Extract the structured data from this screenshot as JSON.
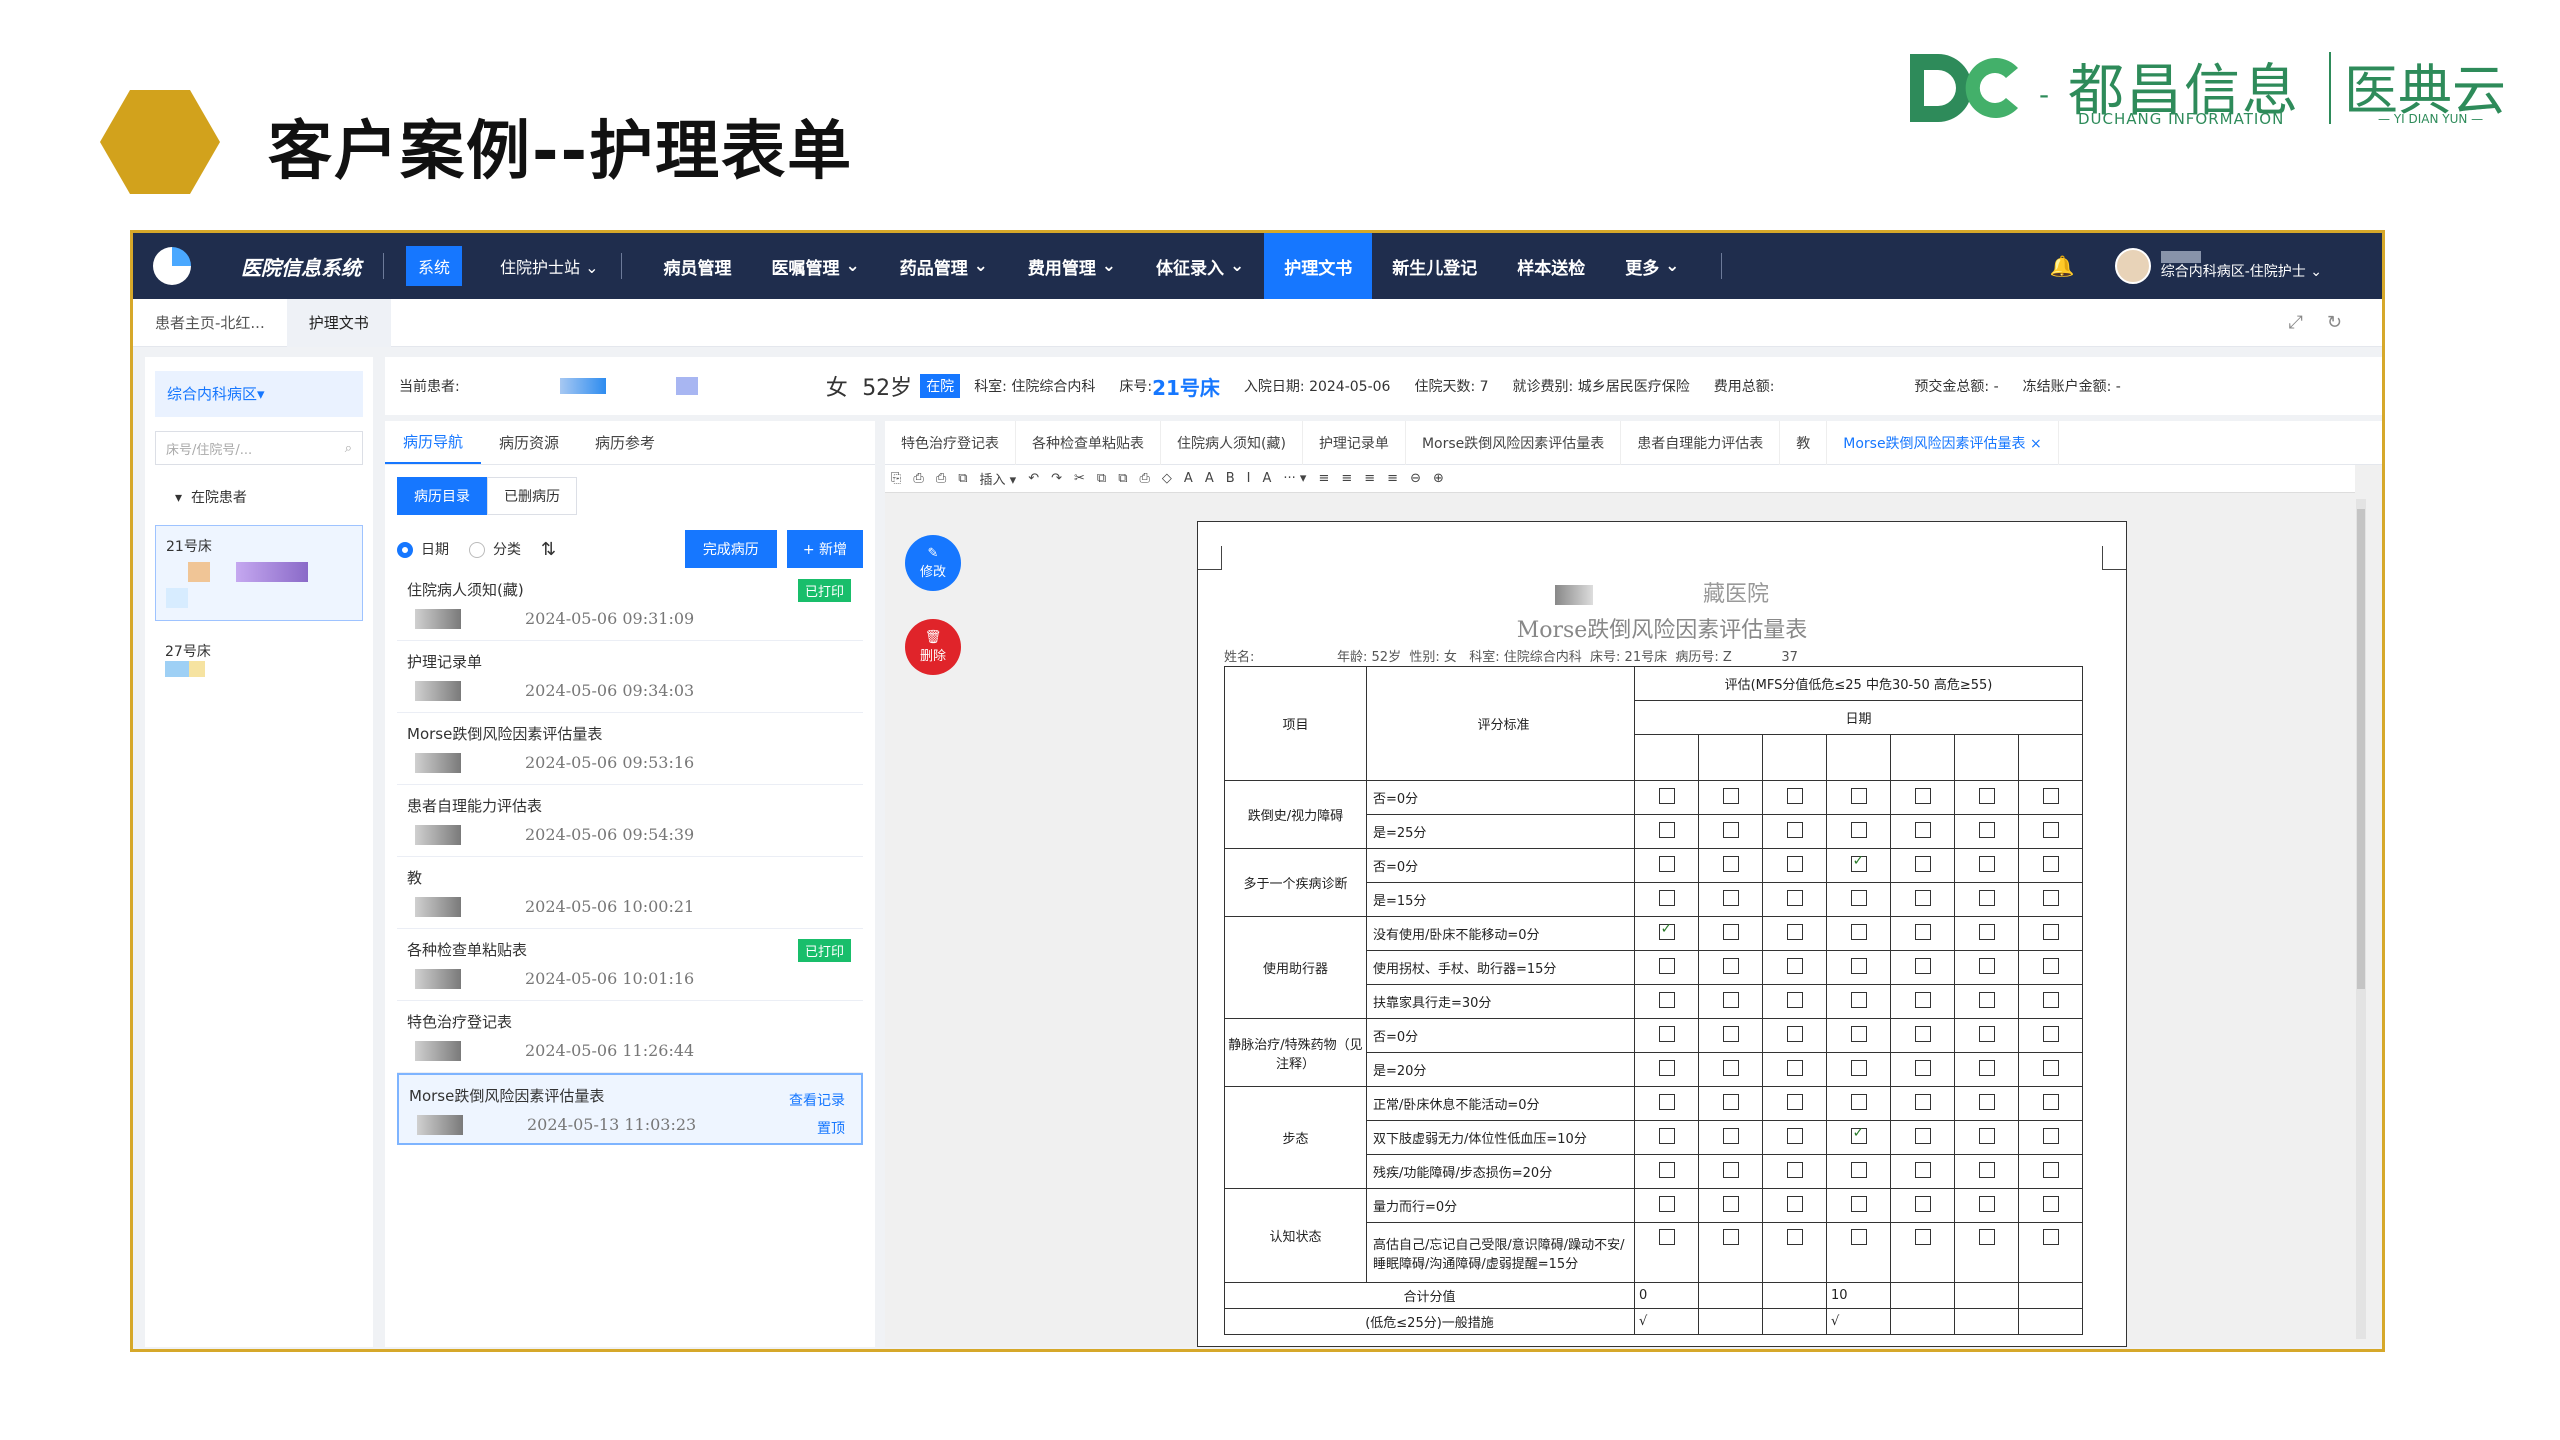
{
  "slide": {
    "title": "客户案例--护理表单"
  },
  "brand": {
    "dash": "-",
    "name_cn": "都昌信息",
    "name_en": "DUCHANG INFORMATION",
    "name2_cn": "医典云",
    "name2_en": "— YI DIAN YUN —"
  },
  "topnav": {
    "app_name": "医院信息系统",
    "sys_label": "系统",
    "role": "住院护士站",
    "items": [
      "病员管理",
      "医嘱管理",
      "药品管理",
      "费用管理",
      "体征录入",
      "护理文书",
      "新生儿登记",
      "样本送检",
      "更多"
    ],
    "active": "护理文书",
    "user_dept": "综合内科病区-住院护士"
  },
  "tabbar": {
    "tabs": [
      "患者主页-北红...",
      "护理文书"
    ]
  },
  "leftcol": {
    "ward": "综合内科病区▾",
    "search_placeholder": "床号/住院号/...",
    "section": "在院患者",
    "beds": [
      "21号床",
      "27号床"
    ]
  },
  "patient": {
    "current_label": "当前患者:",
    "gender": "女",
    "age": "52岁",
    "status": "在院",
    "dept": "科室: 住院综合内科",
    "bed_label": "床号:",
    "bed": "21号床",
    "admit": "入院日期: 2024-05-06",
    "days": "住院天数: 7",
    "payer": "就诊费别: 城乡居民医疗保险",
    "total": "费用总额:",
    "prepay": "预交金总额: -",
    "frozen": "冻结账户金额: -"
  },
  "records": {
    "tabs": [
      "病历导航",
      "病历资源",
      "病历参考"
    ],
    "sub_tabs": [
      "病历目录",
      "已删病历"
    ],
    "opt_date": "日期",
    "opt_cat": "分类",
    "complete_btn": "完成病历",
    "add_btn": "+ 新增",
    "printed_label": "已打印",
    "view_label": "查看记录",
    "top_label": "置顶",
    "items": [
      {
        "title": "住院病人须知(藏)",
        "time": "2024-05-06 09:31:09",
        "printed": true
      },
      {
        "title": "护理记录单",
        "time": "2024-05-06 09:34:03",
        "printed": false
      },
      {
        "title": "Morse跌倒风险因素评估量表",
        "time": "2024-05-06 09:53:16",
        "printed": false
      },
      {
        "title": "患者自理能力评估表",
        "time": "2024-05-06 09:54:39",
        "printed": false
      },
      {
        "title": "教",
        "time": "2024-05-06 10:00:21",
        "printed": false
      },
      {
        "title": "各种检查单粘贴表",
        "time": "2024-05-06 10:01:16",
        "printed": true
      },
      {
        "title": "特色治疗登记表",
        "time": "2024-05-06 11:26:44",
        "printed": false
      },
      {
        "title": "Morse跌倒风险因素评估量表",
        "time": "2024-05-13 11:03:23",
        "printed": false
      }
    ]
  },
  "doc": {
    "tabs": [
      "特色治疗登记表",
      "各种检查单粘贴表",
      "住院病人须知(藏)",
      "护理记录单",
      "Morse跌倒风险因素评估量表",
      "患者自理能力评估表",
      "教",
      "Morse跌倒风险因素评估量表 ×"
    ],
    "toolbar": [
      "⎘",
      "⎙",
      "⎙",
      "⧉",
      "插入 ▾",
      "↶",
      "↷",
      "✂",
      "⧉",
      "⧉",
      "⎙",
      "◇",
      "A",
      "A",
      "B",
      "I",
      "A",
      "··· ▾",
      "≡",
      "≡",
      "≡",
      "≡",
      "⊖",
      "⊕"
    ],
    "edit_label": "修改",
    "delete_label": "删除",
    "hospital": "藏医院",
    "form_title": "Morse跌倒风险因素评估量表",
    "info": "姓名:                    年龄: 52岁  性别: 女   科室: 住院综合内科  床号: 21号床  病历号: Z            37",
    "header_item": "项目",
    "header_criteria": "评分标准",
    "header_eval": "评估(MFS分值低危≤25 中危30-50 高危≥55)",
    "header_date": "日期",
    "rows": [
      {
        "item": "跌倒史/视力障碍",
        "criteria": [
          "否=0分",
          "是=25分"
        ],
        "checked": [
          [],
          []
        ]
      },
      {
        "item": "多于一个疾病诊断",
        "criteria": [
          "否=0分",
          "是=15分"
        ],
        "checked": [
          [
            3
          ],
          []
        ]
      },
      {
        "item": "使用助行器",
        "criteria": [
          "没有使用/卧床不能移动=0分",
          "使用拐杖、手杖、助行器=15分",
          "扶靠家具行走=30分"
        ],
        "checked": [
          [
            0
          ],
          [],
          []
        ]
      },
      {
        "item": "静脉治疗/特殊药物（见注释）",
        "criteria": [
          "否=0分",
          "是=20分"
        ],
        "checked": [
          [],
          []
        ]
      },
      {
        "item": "步态",
        "criteria": [
          "正常/卧床休息不能活动=0分",
          "双下肢虚弱无力/体位性低血压=10分",
          "残疾/功能障碍/步态损伤=20分"
        ],
        "checked": [
          [],
          [
            3
          ],
          []
        ]
      },
      {
        "item": "认知状态",
        "criteria": [
          "量力而行=0分",
          "高估自己/忘记自己受限/意识障碍/躁动不安/睡眠障碍/沟通障碍/虚弱提醒=15分"
        ],
        "checked": [
          [],
          []
        ]
      }
    ],
    "total_label": "合计分值",
    "total_values": [
      "0",
      "",
      "",
      "10",
      "",
      "",
      ""
    ],
    "measure_label": "(低危≤25分)一般措施",
    "measure_values": [
      "√",
      "",
      "",
      "√",
      "",
      "",
      ""
    ]
  }
}
